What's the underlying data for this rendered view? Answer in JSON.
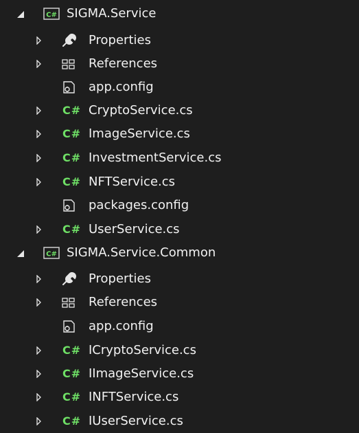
{
  "projects": [
    {
      "name": "SIGMA.Service",
      "items": [
        {
          "label": "Properties",
          "icon": "wrench-icon",
          "expandable": true
        },
        {
          "label": "References",
          "icon": "references-icon",
          "expandable": true
        },
        {
          "label": "app.config",
          "icon": "config-file-icon",
          "expandable": false
        },
        {
          "label": "CryptoService.cs",
          "icon": "csharp-file-icon",
          "expandable": true
        },
        {
          "label": "ImageService.cs",
          "icon": "csharp-file-icon",
          "expandable": true
        },
        {
          "label": "InvestmentService.cs",
          "icon": "csharp-file-icon",
          "expandable": true
        },
        {
          "label": "NFTService.cs",
          "icon": "csharp-file-icon",
          "expandable": true
        },
        {
          "label": "packages.config",
          "icon": "config-file-icon",
          "expandable": false
        },
        {
          "label": "UserService.cs",
          "icon": "csharp-file-icon",
          "expandable": true
        }
      ]
    },
    {
      "name": "SIGMA.Service.Common",
      "items": [
        {
          "label": "Properties",
          "icon": "wrench-icon",
          "expandable": true
        },
        {
          "label": "References",
          "icon": "references-icon",
          "expandable": true
        },
        {
          "label": "app.config",
          "icon": "config-file-icon",
          "expandable": false
        },
        {
          "label": "ICryptoService.cs",
          "icon": "csharp-file-icon",
          "expandable": true
        },
        {
          "label": "IImageService.cs",
          "icon": "csharp-file-icon",
          "expandable": true
        },
        {
          "label": "INFTService.cs",
          "icon": "csharp-file-icon",
          "expandable": true
        },
        {
          "label": "IUserService.cs",
          "icon": "csharp-file-icon",
          "expandable": true
        }
      ]
    }
  ],
  "csharp_glyph": "C#",
  "colors": {
    "background": "#1e1e1e",
    "text": "#f2f2f2",
    "csharp_green": "#6fe066",
    "project_icon_border": "#8ad07e"
  }
}
